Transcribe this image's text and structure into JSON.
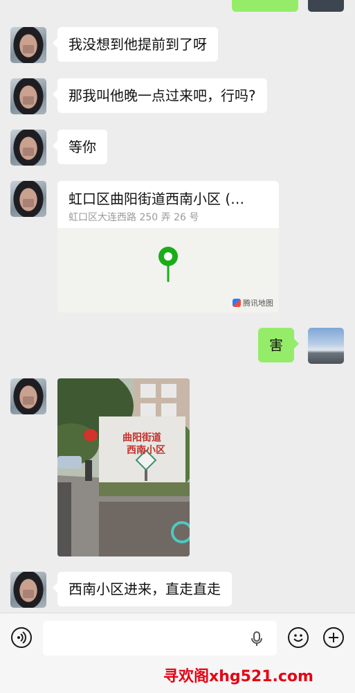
{
  "messages": [
    {
      "side": "left",
      "text": "我没想到他提前到了呀"
    },
    {
      "side": "left",
      "text": "那我叫他晚一点过来吧，行吗?"
    },
    {
      "side": "left",
      "text": "等你"
    },
    {
      "side": "left",
      "type": "location",
      "title": "虹口区曲阳街道西南小区 (…",
      "address": "虹口区大连西路 250 弄 26 号",
      "map_brand": "腾讯地图"
    },
    {
      "side": "right",
      "text": "害"
    },
    {
      "side": "left",
      "type": "image",
      "sign_text_line1": "曲阳街道",
      "sign_text_line2": "西南小区"
    },
    {
      "side": "left",
      "text": "西南小区进来，直走直走"
    }
  ],
  "input_bar": {
    "value": "",
    "icons": [
      "voice-icon",
      "microphone-icon",
      "emoji-icon",
      "plus-icon"
    ]
  },
  "watermark": {
    "text": "寻欢阁xhg521.com",
    "color": "#e60012"
  },
  "colors": {
    "background": "#ededed",
    "bubble_right": "#95ec69",
    "bubble_left": "#ffffff",
    "pin": "#1aad19"
  }
}
